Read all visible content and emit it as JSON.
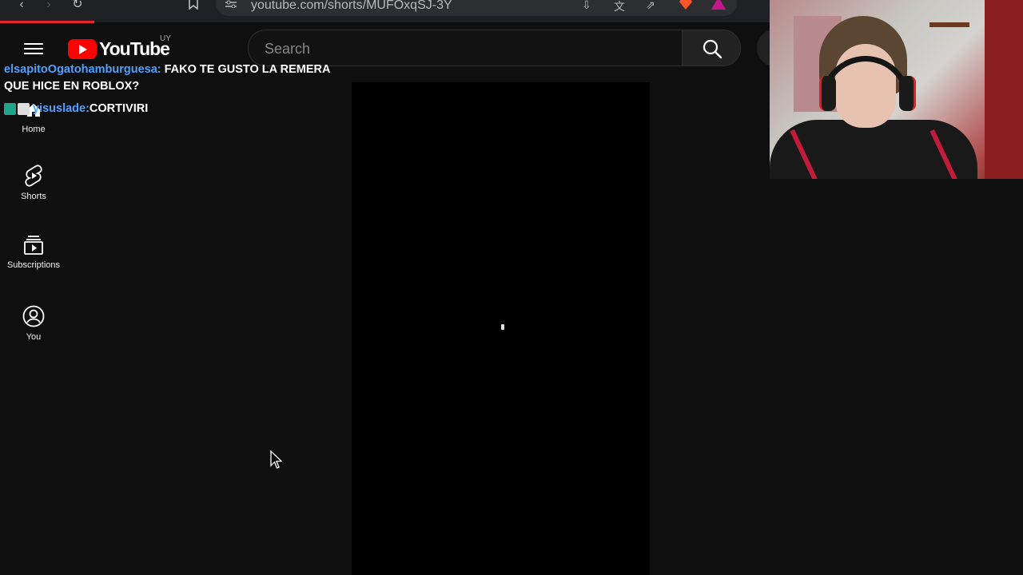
{
  "browser": {
    "url": "youtube.com/shorts/MUFOxqSJ-3Y",
    "back_glyph": "‹",
    "forward_glyph": "›",
    "reload_glyph": "↻",
    "icons": [
      "bookmark-icon",
      "site-settings-icon",
      "install-app-icon",
      "translate-icon",
      "share-icon",
      "brave-shields-icon",
      "brave-rewards-icon"
    ]
  },
  "youtube": {
    "logo_text": "YouTube",
    "country_code": "UY",
    "search_placeholder": "Search"
  },
  "chat": [
    {
      "user": "elsapitoOgatohamburguesa:",
      "message": " FAKO TE GUSTO LA REMERA QUE HICE EN ROBLOX?"
    },
    {
      "user": "yisuslade:",
      "message": " CORTIVIRI"
    }
  ],
  "sidebar": {
    "items": [
      {
        "label": "Home",
        "icon": "home-icon"
      },
      {
        "label": "Shorts",
        "icon": "shorts-icon"
      },
      {
        "label": "Subscriptions",
        "icon": "subscriptions-icon"
      },
      {
        "label": "You",
        "icon": "you-icon"
      }
    ]
  },
  "colors": {
    "background": "#0f0f0f",
    "youtube_red": "#ff0000",
    "chat_username": "#4ea1ff",
    "video_bg": "#000000"
  }
}
